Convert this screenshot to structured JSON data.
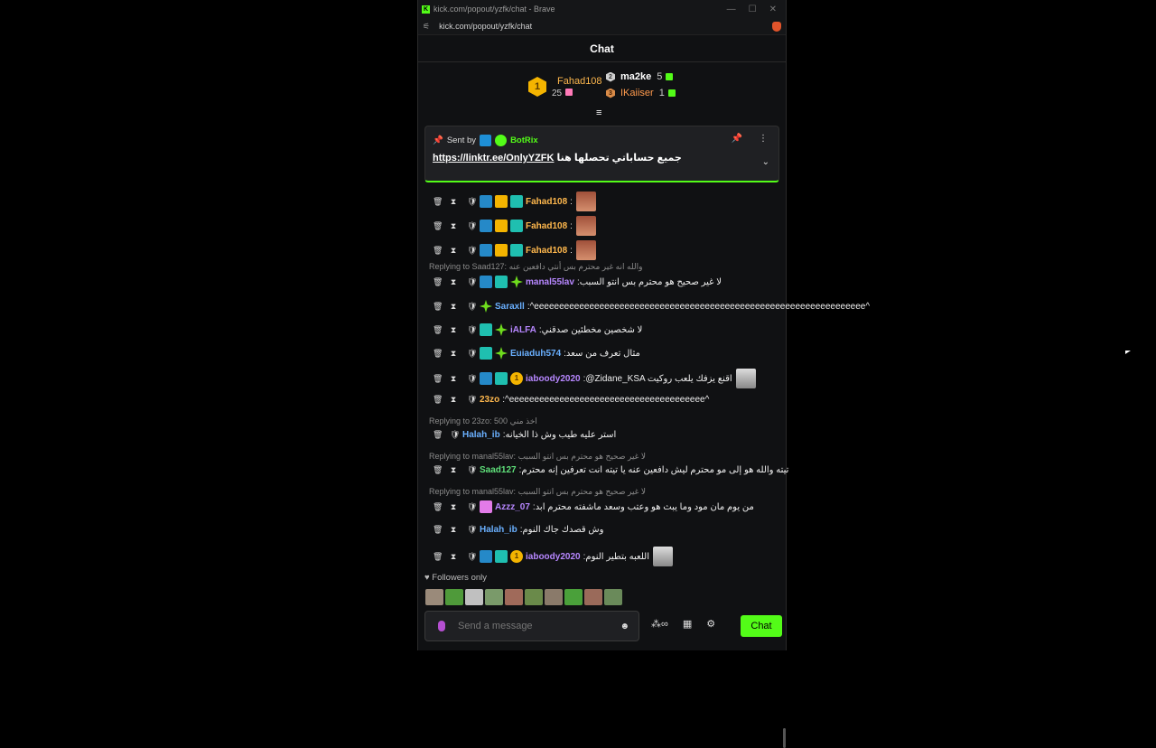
{
  "browser": {
    "tab_title": "kick.com/popout/yzfk/chat - Brave",
    "favicon": "K",
    "url": "kick.com/popout/yzfk/chat"
  },
  "header": {
    "title": "Chat"
  },
  "leaderboard": {
    "first": {
      "rank": "1",
      "name": "Fahad108",
      "count": "25"
    },
    "second": {
      "rank": "2",
      "name": "ma2ke",
      "count": "5"
    },
    "third": {
      "rank": "3",
      "name": "IKaiiser",
      "count": "1"
    }
  },
  "pinned": {
    "sent_by_label": "Sent by",
    "author": "BotRix",
    "text": "جميع حساباتي تحصلها هنا",
    "link": "https://linktr.ee/OnlyYZFK"
  },
  "messages": [
    {
      "user": "Fahad108",
      "text": ""
    },
    {
      "user": "Fahad108",
      "text": ""
    },
    {
      "user": "Fahad108",
      "text": ""
    },
    {
      "reply": "Replying to Saad127: والله انه غير محترم بس أنتي دافعين عنه"
    },
    {
      "user": "manal55lav",
      "text": "لا غير صحيح هو محترم بس انتو السبب"
    },
    {
      "user": "Saraxll",
      "text": "^eeeeeeeeeeeeeeeeeeeeeeeeeeeeeeeeeeeeeeeeeeeeeeeeeeeeeeeeeeeeeeeeee^"
    },
    {
      "user": "iALFA",
      "text": "لا شخصين مخطئين صدقني"
    },
    {
      "user": "Euiaduh574",
      "text": "مثال تعرف من سعد"
    },
    {
      "user": "iaboody2020",
      "text": "@Zidane_KSA اقنع يزفك يلعب روكيت"
    },
    {
      "user": "23zo",
      "text": "^eeeeeeeeeeeeeeeeeeeeeeeeeeeeeeeeeeeeeee^"
    },
    {
      "reply": "Replying to 23zo: 500 اخذ مني"
    },
    {
      "user": "Halah_ib",
      "text": "استر عليه طيب وش ذا الخيانه"
    },
    {
      "reply": "Replying to manal55lav: لا غير صحيح هو محترم بس انتو السبب"
    },
    {
      "user": "Saad127",
      "text": "تيته والله هو إلى مو محترم ليش دافعين عنه يا تيته انت تعرفين إنه محترم"
    },
    {
      "reply": "Replying to manal55lav: لا غير صحيح هو محترم بس انتو السبب"
    },
    {
      "user": "Azzz_07",
      "text": "من يوم مان مود وما يبث هو وعتب وسعد ماشفته محترم ابد"
    },
    {
      "user": "Halah_ib",
      "text": "وش قصدك جاك النوم"
    },
    {
      "user": "iaboody2020",
      "text": "اللعبه بتطير النوم"
    }
  ],
  "followers_label": "Followers only",
  "input": {
    "placeholder": "Send a message"
  },
  "chat_button": "Chat",
  "colors": {
    "accent": "#53fc18",
    "background": "#101113"
  }
}
